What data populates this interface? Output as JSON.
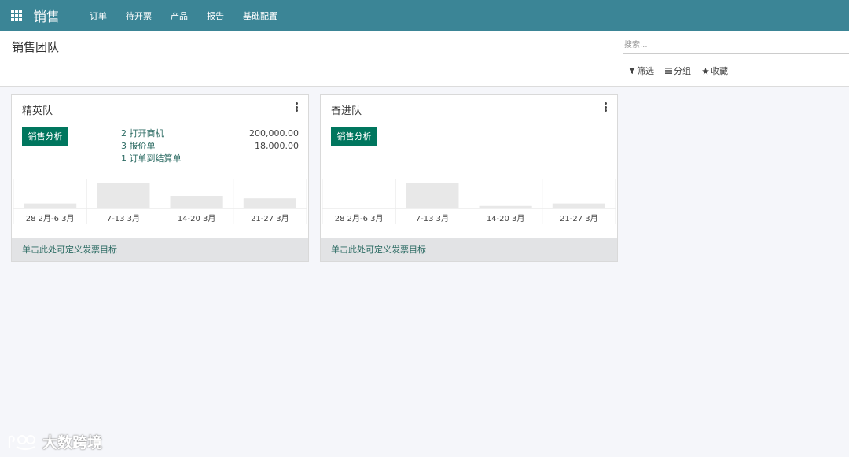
{
  "navbar": {
    "brand": "销售",
    "items": [
      "订单",
      "待开票",
      "产品",
      "报告",
      "基础配置"
    ]
  },
  "control_panel": {
    "title": "销售团队",
    "search_placeholder": "搜索...",
    "filters": {
      "filter": "筛选",
      "group": "分组",
      "favorite": "收藏"
    }
  },
  "teams": [
    {
      "name": "精英队",
      "analysis_label": "销售分析",
      "stats": [
        {
          "label": "2 打开商机",
          "value": "200,000.00"
        },
        {
          "label": "3 报价单",
          "value": "18,000.00"
        },
        {
          "label": "1 订单到结算单",
          "value": ""
        }
      ],
      "chart_data": {
        "type": "bar",
        "categories": [
          "28 2月-6 3月",
          "7-13 3月",
          "14-20 3月",
          "21-27 3月"
        ],
        "values": [
          0.2,
          1.0,
          0.5,
          0.4
        ]
      },
      "footer": "单击此处可定义发票目标"
    },
    {
      "name": "奋进队",
      "analysis_label": "销售分析",
      "stats": [],
      "chart_data": {
        "type": "bar",
        "categories": [
          "28 2月-6 3月",
          "7-13 3月",
          "14-20 3月",
          "21-27 3月"
        ],
        "values": [
          0,
          1.0,
          0.1,
          0.2
        ]
      },
      "footer": "单击此处可定义发票目标"
    }
  ],
  "watermark": "大数跨境",
  "colors": {
    "navbar": "#3b8596",
    "button": "#00765e",
    "bar": "#e8e8e8"
  }
}
